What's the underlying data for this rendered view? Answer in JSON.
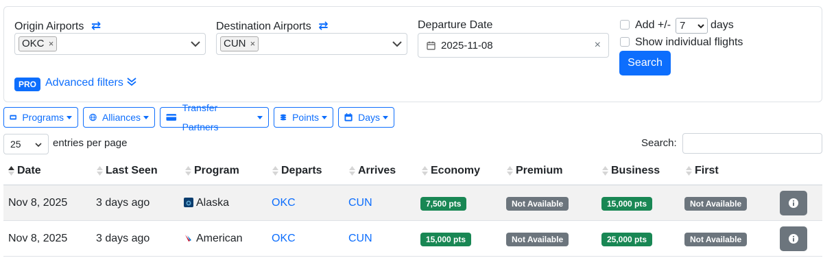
{
  "search": {
    "origin_label": "Origin Airports",
    "origin_tag": "OKC",
    "destination_label": "Destination Airports",
    "destination_tag": "CUN",
    "departure_label": "Departure Date",
    "departure_value": "2025-11-08",
    "add_days_prefix": "Add +/-",
    "add_days_value": "7",
    "add_days_suffix": "days",
    "show_individual_label": "Show individual flights",
    "search_button": "Search",
    "pro_badge": "PRO",
    "advanced_filters": "Advanced filters",
    "tag_remove_glyph": "×",
    "clear_glyph": "×"
  },
  "filters": [
    "Programs",
    "Alliances",
    "Transfer Partners",
    "Points",
    "Days"
  ],
  "table_controls": {
    "entries_value": "25",
    "entries_label": "entries per page",
    "search_label": "Search:"
  },
  "columns": [
    "Date",
    "Last Seen",
    "Program",
    "Departs",
    "Arrives",
    "Economy",
    "Premium",
    "Business",
    "First"
  ],
  "rows": [
    {
      "date": "Nov 8, 2025",
      "last_seen": "3 days ago",
      "program": "Alaska",
      "departs": "OKC",
      "arrives": "CUN",
      "economy": "7,500 pts",
      "premium": "Not Available",
      "business": "15,000 pts",
      "first": "Not Available"
    },
    {
      "date": "Nov 8, 2025",
      "last_seen": "3 days ago",
      "program": "American",
      "departs": "OKC",
      "arrives": "CUN",
      "economy": "15,000 pts",
      "premium": "Not Available",
      "business": "25,000 pts",
      "first": "Not Available"
    }
  ],
  "colors": {
    "primary": "#0d6efd",
    "available": "#198754",
    "unavailable": "#6c757d",
    "stripe": "#f2f2f2"
  }
}
